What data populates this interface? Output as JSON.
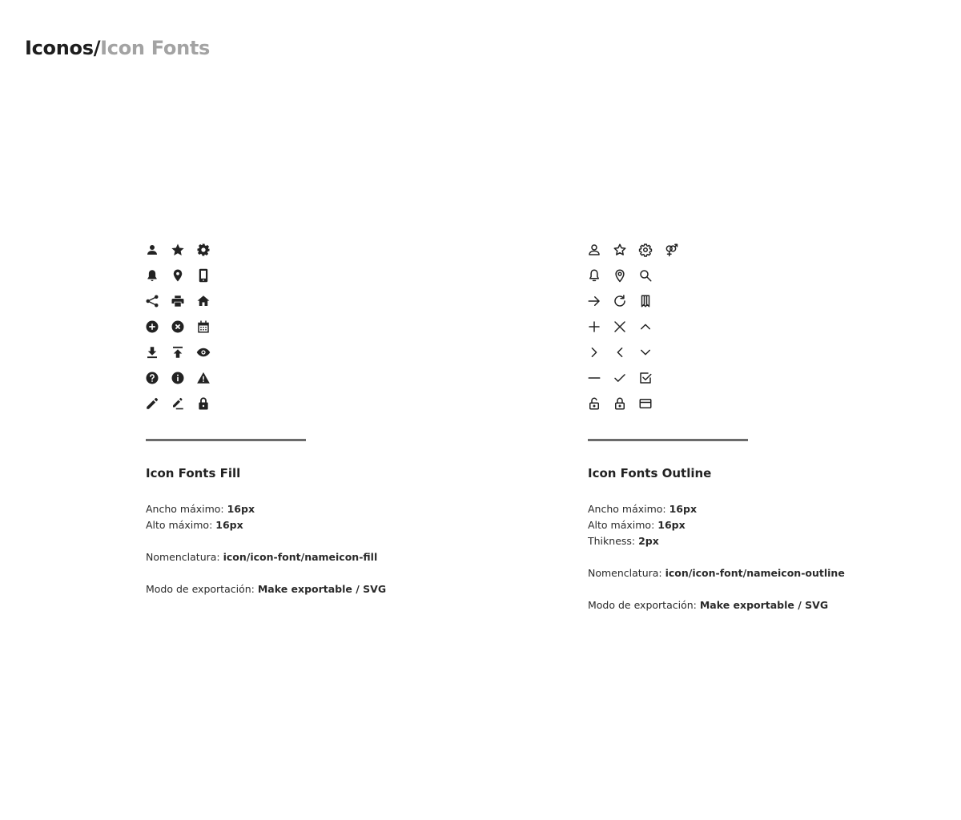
{
  "header": {
    "title_main": "Iconos/",
    "title_sub": "Icon Fonts"
  },
  "sections": {
    "fill": {
      "heading": "Icon Fonts Fill",
      "width_label": "Ancho máximo: ",
      "width_value": "16px",
      "height_label": "Alto máximo: ",
      "height_value": "16px",
      "naming_label": "Nomenclatura: ",
      "naming_value": "icon/icon-font/nameicon-fill",
      "export_label": "Modo de exportación: ",
      "export_value": "Make exportable / SVG",
      "icons": [
        [
          "user-icon",
          "star-icon",
          "gear-icon"
        ],
        [
          "bell-icon",
          "location-pin-icon",
          "smartphone-icon"
        ],
        [
          "share-icon",
          "printer-icon",
          "home-icon"
        ],
        [
          "add-circle-icon",
          "close-circle-icon",
          "calendar-icon"
        ],
        [
          "download-icon",
          "upload-icon",
          "eye-icon"
        ],
        [
          "help-circle-icon",
          "info-circle-icon",
          "warning-icon"
        ],
        [
          "pencil-icon",
          "edit-icon",
          "lock-icon"
        ]
      ]
    },
    "outline": {
      "heading": "Icon Fonts Outline",
      "width_label": "Ancho máximo: ",
      "width_value": "16px",
      "height_label": "Alto máximo: ",
      "height_value": "16px",
      "thickness_label": "Thikness: ",
      "thickness_value": "2px",
      "naming_label": "Nomenclatura: ",
      "naming_value": "icon/icon-font/nameicon-outline",
      "export_label": "Modo de exportación: ",
      "export_value": "Make exportable / SVG",
      "icons": [
        [
          "user-icon",
          "star-icon",
          "gear-icon",
          "gender-icon"
        ],
        [
          "bell-icon",
          "location-pin-icon",
          "search-icon"
        ],
        [
          "arrow-right-icon",
          "refresh-icon",
          "bookmark-icon"
        ],
        [
          "plus-icon",
          "close-icon",
          "chevron-up-icon"
        ],
        [
          "chevron-right-icon",
          "chevron-left-icon",
          "chevron-down-icon"
        ],
        [
          "minus-icon",
          "check-icon",
          "checkbox-icon"
        ],
        [
          "lock-open-icon",
          "lock-icon",
          "credit-card-icon"
        ]
      ]
    }
  }
}
